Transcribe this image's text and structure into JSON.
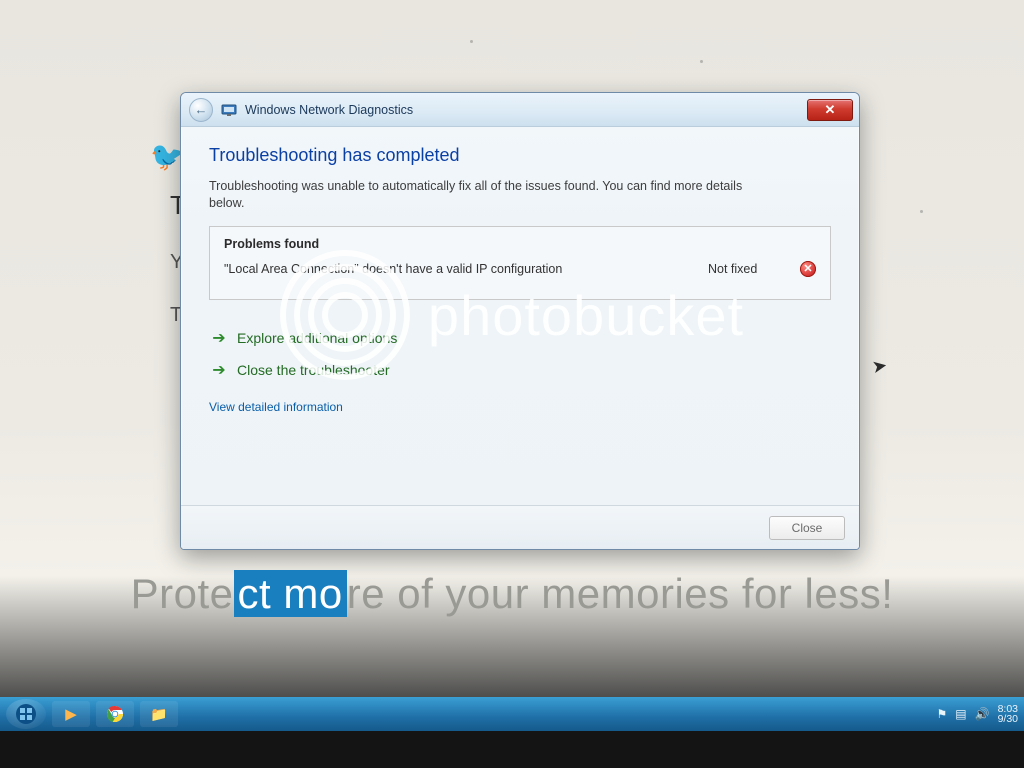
{
  "dialog": {
    "title": "Windows Network Diagnostics",
    "heading": "Troubleshooting has completed",
    "subtext": "Troubleshooting was unable to automatically fix all of the issues found. You can find more details below.",
    "problems_title": "Problems found",
    "problems": [
      {
        "desc": "\"Local Area Connection\" doesn't have a valid IP configuration",
        "status": "Not fixed"
      }
    ],
    "options": [
      {
        "label": "Explore additional options"
      },
      {
        "label": "Close the troubleshooter"
      }
    ],
    "detailed_link": "View detailed information",
    "close_button": "Close"
  },
  "watermark": {
    "brand": "photobucket",
    "tagline_pre": "Prote",
    "tagline_hl": "ct mo",
    "tagline_post": "re of your memories for less!"
  },
  "taskbar": {
    "time": "8:03",
    "date": "9/30"
  }
}
